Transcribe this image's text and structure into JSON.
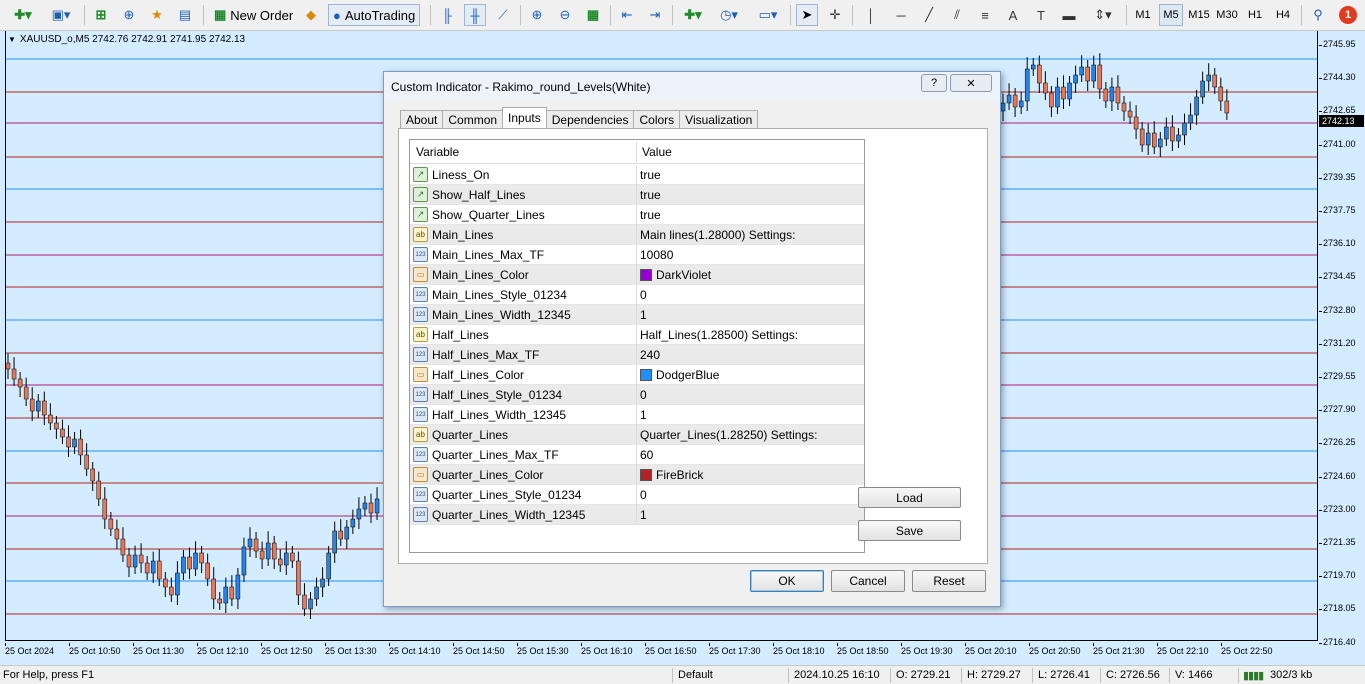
{
  "toolbar": {
    "new_order": "New Order",
    "autotrading": "AutoTrading",
    "timeframes": [
      "M1",
      "M5",
      "M15",
      "M30",
      "H1",
      "H4"
    ],
    "active_timeframe": "M5",
    "alerts_badge": "1"
  },
  "chart": {
    "symbol_line": "XAUUSD_o,M5  2742.76 2742.91 2741.95 2742.13",
    "current_price": "2742.13",
    "price_labels": [
      "2745.95",
      "2744.30",
      "2742.65",
      "2741.00",
      "2739.35",
      "2737.75",
      "2736.10",
      "2734.45",
      "2732.80",
      "2731.20",
      "2729.55",
      "2727.90",
      "2726.25",
      "2724.60",
      "2723.00",
      "2721.35",
      "2719.70",
      "2718.05",
      "2716.40"
    ],
    "time_labels": [
      "25 Oct 2024",
      "25 Oct 10:50",
      "25 Oct 11:30",
      "25 Oct 12:10",
      "25 Oct 12:50",
      "25 Oct 13:30",
      "25 Oct 14:10",
      "25 Oct 14:50",
      "25 Oct 15:30",
      "25 Oct 16:10",
      "25 Oct 16:50",
      "25 Oct 17:30",
      "25 Oct 18:10",
      "25 Oct 18:50",
      "25 Oct 19:30",
      "25 Oct 20:10",
      "25 Oct 20:50",
      "25 Oct 21:30",
      "25 Oct 22:10",
      "25 Oct 22:50"
    ],
    "colors": {
      "background": "#d4ecff",
      "bull": "#2a82e4",
      "bear": "#e8785a",
      "violet_line": "#b21c7a",
      "blue_line": "#1e90ff",
      "red_line": "#b22222"
    }
  },
  "dialog": {
    "title": "Custom Indicator - Rakimo_round_Levels(White)",
    "help_label": "?",
    "close_label": "✕",
    "tabs": [
      "About",
      "Common",
      "Inputs",
      "Dependencies",
      "Colors",
      "Visualization"
    ],
    "active_tab": "Inputs",
    "columns": {
      "variable": "Variable",
      "value": "Value"
    },
    "rows": [
      {
        "icon": "bool",
        "variable": "Liness_On",
        "value": "true"
      },
      {
        "icon": "bool",
        "variable": "Show_Half_Lines",
        "value": "true"
      },
      {
        "icon": "bool",
        "variable": "Show_Quarter_Lines",
        "value": "true"
      },
      {
        "icon": "str",
        "variable": "Main_Lines",
        "value": " Main lines(1.28000) Settings:"
      },
      {
        "icon": "int",
        "variable": "Main_Lines_Max_TF",
        "value": "10080"
      },
      {
        "icon": "col",
        "variable": "Main_Lines_Color",
        "value": "DarkViolet",
        "swatch": "#9400d3"
      },
      {
        "icon": "int",
        "variable": "Main_Lines_Style_01234",
        "value": "0"
      },
      {
        "icon": "int",
        "variable": "Main_Lines_Width_12345",
        "value": "1"
      },
      {
        "icon": "str",
        "variable": "Half_Lines",
        "value": " Half_Lines(1.28500) Settings:"
      },
      {
        "icon": "int",
        "variable": "Half_Lines_Max_TF",
        "value": "240"
      },
      {
        "icon": "col",
        "variable": "Half_Lines_Color",
        "value": "DodgerBlue",
        "swatch": "#1e90ff"
      },
      {
        "icon": "int",
        "variable": "Half_Lines_Style_01234",
        "value": "0"
      },
      {
        "icon": "int",
        "variable": "Half_Lines_Width_12345",
        "value": "1"
      },
      {
        "icon": "str",
        "variable": "Quarter_Lines",
        "value": " Quarter_Lines(1.28250) Settings:"
      },
      {
        "icon": "int",
        "variable": "Quarter_Lines_Max_TF",
        "value": "60"
      },
      {
        "icon": "col",
        "variable": "Quarter_Lines_Color",
        "value": "FireBrick",
        "swatch": "#b22222"
      },
      {
        "icon": "int",
        "variable": "Quarter_Lines_Style_01234",
        "value": "0"
      },
      {
        "icon": "int",
        "variable": "Quarter_Lines_Width_12345",
        "value": "1"
      }
    ],
    "load_label": "Load",
    "save_label": "Save",
    "ok_label": "OK",
    "cancel_label": "Cancel",
    "reset_label": "Reset"
  },
  "status": {
    "help": "For Help, press F1",
    "profile": "Default",
    "datetime": "2024.10.25 16:10",
    "open": "O: 2729.21",
    "high": "H: 2729.27",
    "low": "L: 2726.41",
    "close": "C: 2726.56",
    "volume": "V: 1466",
    "traffic": "302/3 kb"
  }
}
